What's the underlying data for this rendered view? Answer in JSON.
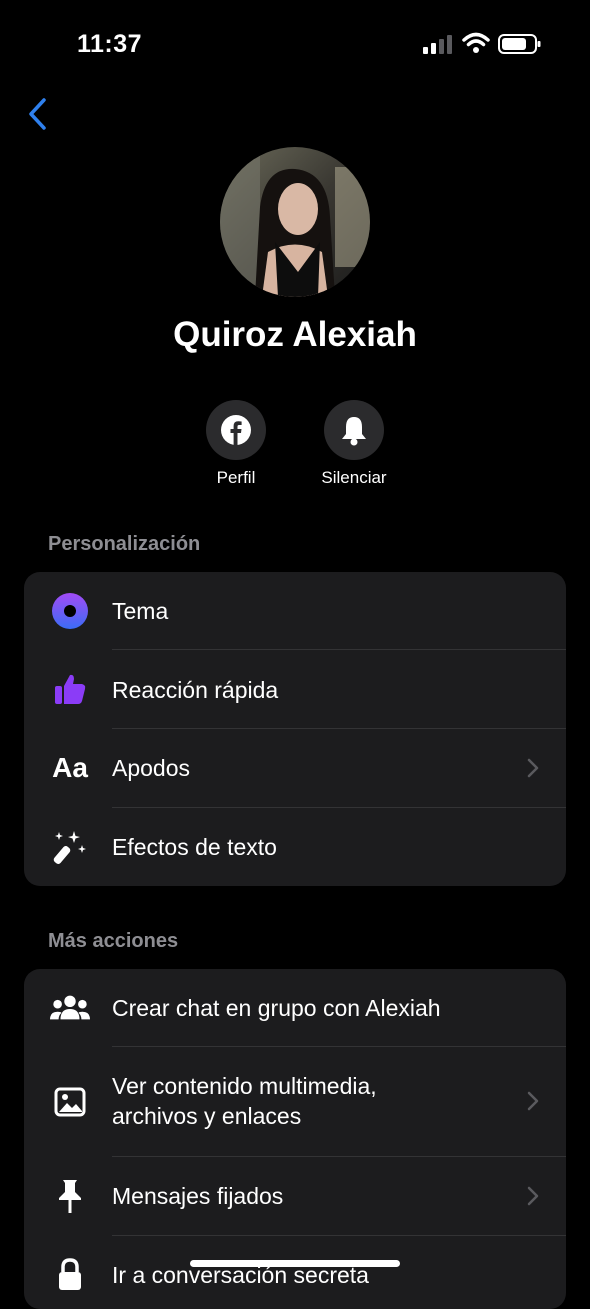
{
  "status_bar": {
    "time": "11:37"
  },
  "profile": {
    "name": "Quiroz Alexiah"
  },
  "actions": [
    {
      "label": "Perfil",
      "icon": "facebook-icon"
    },
    {
      "label": "Silenciar",
      "icon": "bell-icon"
    }
  ],
  "sections": {
    "personalization": {
      "title": "Personalización",
      "items": [
        {
          "label": "Tema",
          "icon": "theme-circle-icon"
        },
        {
          "label": "Reacción rápida",
          "icon": "thumbs-up-icon"
        },
        {
          "label": "Apodos",
          "icon": "text-aa-icon",
          "icon_text": "Aa"
        },
        {
          "label": "Efectos de texto",
          "icon": "magic-wand-icon"
        }
      ]
    },
    "more_actions": {
      "title": "Más acciones",
      "items": [
        {
          "label": "Crear chat en grupo con Alexiah",
          "icon": "people-icon"
        },
        {
          "label": "Ver contenido multimedia,",
          "label2": "archivos y enlaces",
          "icon": "image-icon"
        },
        {
          "label": "Mensajes fijados",
          "icon": "pin-icon"
        },
        {
          "label": "Ir a conversación secreta",
          "icon": "lock-icon"
        }
      ]
    }
  },
  "colors": {
    "accent": "#2f80ed",
    "purple": "#8b3cf7",
    "card": "#1c1c1e",
    "muted": "#8e8e93"
  }
}
